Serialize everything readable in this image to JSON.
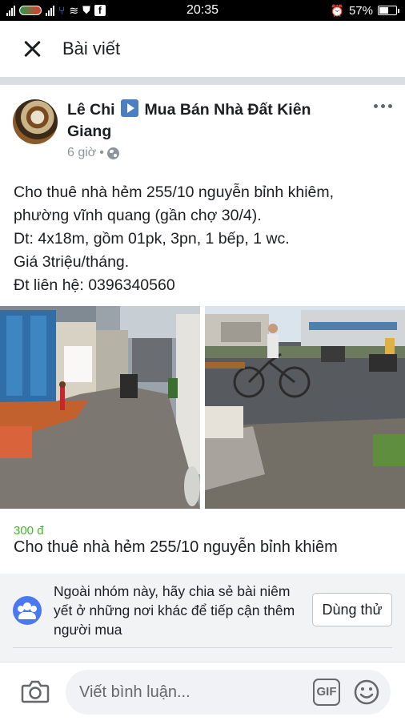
{
  "status_bar": {
    "time": "20:35",
    "battery": "57%",
    "battery_level": 0.57
  },
  "header": {
    "title": "Bài viết"
  },
  "post": {
    "author": "Lê Chi",
    "group": "Mua Bán Nhà Đất Kiên Giang",
    "time": "6 giờ",
    "meta_separator": "•",
    "text_lines": [
      "Cho thuê nhà hẻm 255/10 nguyễn bỉnh khiêm,",
      "phường vĩnh quang (gần chợ 30/4).",
      "Dt: 4x18m, gồm 01pk, 3pn, 1 bếp, 1 wc.",
      "Giá 3triệu/tháng.",
      "Đt liên hệ: 0396340560"
    ]
  },
  "listing": {
    "price": "300 đ",
    "title": "Cho thuê nhà hẻm 255/10 nguyễn bỉnh khiêm"
  },
  "suggestion": {
    "text": "Ngoài nhóm này, hãy chia sẻ bài niêm yết ở những nơi khác để tiếp cận thêm người mua",
    "button_label": "Dùng thử"
  },
  "comment_bar": {
    "placeholder": "Viết bình luận...",
    "gif_label": "GIF"
  },
  "icons": {
    "close": "close-icon",
    "more": "more-icon",
    "globe": "globe-icon",
    "group": "group-icon",
    "camera": "camera-icon",
    "emoji": "emoji-icon"
  },
  "colors": {
    "price": "#42b72a",
    "group_icon": "#4a78f0",
    "secondary_text": "#90949c"
  }
}
